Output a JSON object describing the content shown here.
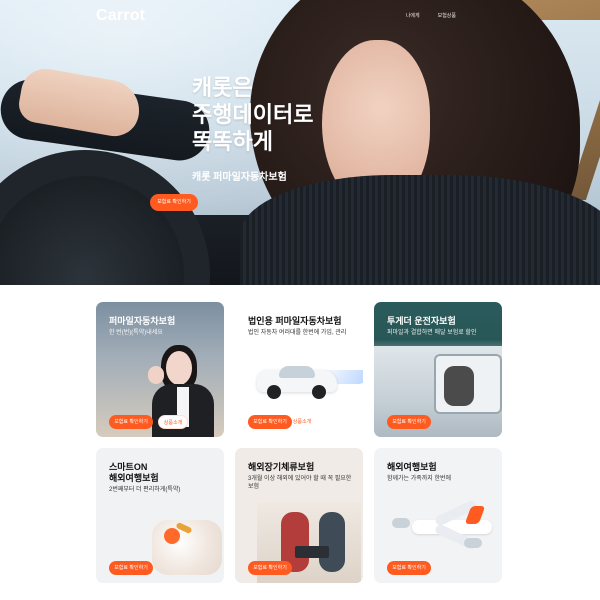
{
  "brand": {
    "logo": "Carrot",
    "accent": "#ff5b21"
  },
  "header": {
    "nav": [
      "나에게",
      "보험상품",
      "",
      "",
      ""
    ]
  },
  "hero": {
    "title_lines": [
      "캐롯은",
      "주행데이터로",
      "똑똑하게"
    ],
    "subtitle": "캐롯 퍼마일자동차보험",
    "cta": "보험료 확인하기"
  },
  "products": [
    {
      "title": "퍼마일자동차보험",
      "desc": "한 번(번)(특약)내세요",
      "cta_primary": "보험료 확인하기",
      "cta_secondary": "상품소개"
    },
    {
      "title": "법인용 퍼마일자동차보험",
      "desc": "법인 자동차 여러대를 한번에 가입, 관리",
      "cta_primary": "보험료 확인하기",
      "cta_secondary": "상품소개"
    },
    {
      "title": "투게더 운전자보험",
      "desc": "퍼마일과 결합하면 매달 보험료 할인",
      "cta_primary": "보험료 확인하기"
    },
    {
      "title_lines": [
        "스마트ON",
        "해외여행보험"
      ],
      "desc": "2번째부터 더 편리하게(특약)",
      "cta_primary": "보험료 확인하기"
    },
    {
      "title": "해외장기체류보험",
      "desc": "3개월 이상 해외에 있어야 할 때 꼭 필요한 보험",
      "cta_primary": "보험료 확인하기"
    },
    {
      "title": "해외여행보험",
      "desc": "함께가는 가족까지 한번에",
      "cta_primary": "보험료 확인하기"
    }
  ],
  "icons": [
    "carrot-logo",
    "woman-photo",
    "car-photo",
    "snow-car-photo",
    "phone-keyfob-photo",
    "people-photo",
    "airplane-photo"
  ]
}
